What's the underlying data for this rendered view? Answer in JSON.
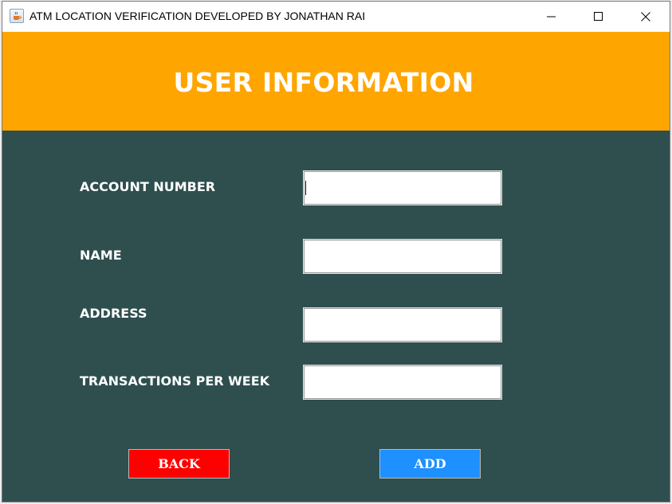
{
  "window": {
    "title": "ATM LOCATION VERIFICATION DEVELOPED BY JONATHAN RAI",
    "icons": {
      "app": "java-cup-icon",
      "minimize": "minimize-icon",
      "maximize": "maximize-icon",
      "close": "close-icon"
    }
  },
  "header": {
    "title": "USER INFORMATION",
    "background": "#ffa500"
  },
  "form": {
    "background": "#2f4f4f",
    "fields": [
      {
        "label": "ACCOUNT NUMBER",
        "value": "",
        "focused": true
      },
      {
        "label": "NAME",
        "value": ""
      },
      {
        "label": "ADDRESS",
        "value": ""
      },
      {
        "label": "TRANSACTIONS PER WEEK",
        "value": ""
      }
    ]
  },
  "buttons": {
    "back": {
      "label": "BACK",
      "color": "#ff0000"
    },
    "add": {
      "label": "ADD",
      "color": "#1e90ff"
    }
  }
}
